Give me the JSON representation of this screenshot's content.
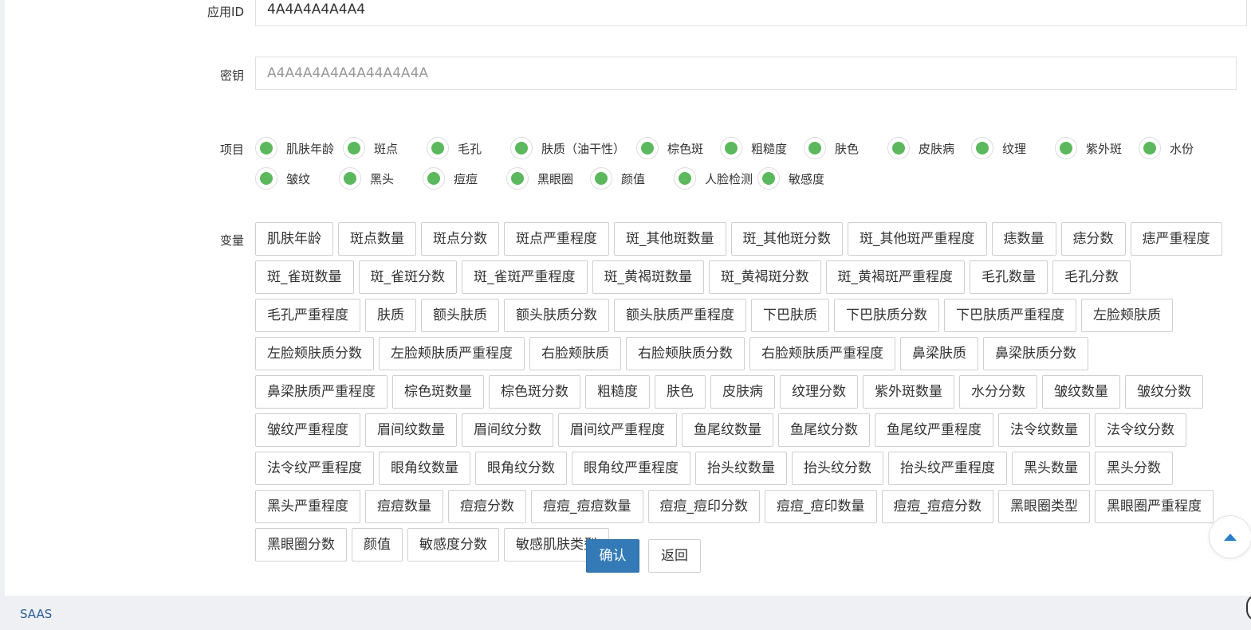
{
  "form": {
    "app_id": {
      "label": "应用ID",
      "value": "4A4A4A4A4A4"
    },
    "secret": {
      "label": "密钥",
      "placeholder": "A4A4A4A4A4A44A4A4A"
    },
    "projects": {
      "label": "项目",
      "items": [
        "肌肤年龄",
        "斑点",
        "毛孔",
        "肤质（油干性）",
        "棕色斑",
        "粗糙度",
        "肤色",
        "皮肤病",
        "纹理",
        "紫外斑",
        "水份",
        "皱纹",
        "黑头",
        "痘痘",
        "黑眼圈",
        "颜值",
        "人脸检测",
        "敏感度"
      ],
      "radio_color": "#5cb85c"
    },
    "variables": {
      "label": "变量",
      "rows": [
        [
          "肌肤年龄",
          "斑点数量",
          "斑点分数",
          "斑点严重程度",
          "斑_其他斑数量",
          "斑_其他斑分数",
          "斑_其他斑严重程度",
          "痣数量",
          "痣分数",
          "痣严重程度"
        ],
        [
          "斑_雀斑数量",
          "斑_雀斑分数",
          "斑_雀斑严重程度",
          "斑_黄褐斑数量",
          "斑_黄褐斑分数",
          "斑_黄褐斑严重程度",
          "毛孔数量",
          "毛孔分数"
        ],
        [
          "毛孔严重程度",
          "肤质",
          "额头肤质",
          "额头肤质分数",
          "额头肤质严重程度",
          "下巴肤质",
          "下巴肤质分数",
          "下巴肤质严重程度",
          "左脸颊肤质"
        ],
        [
          "左脸颊肤质分数",
          "左脸颊肤质严重程度",
          "右脸颊肤质",
          "右脸颊肤质分数",
          "右脸颊肤质严重程度",
          "鼻梁肤质",
          "鼻梁肤质分数"
        ],
        [
          "鼻梁肤质严重程度",
          "棕色斑数量",
          "棕色斑分数",
          "粗糙度",
          "肤色",
          "皮肤病",
          "纹理分数",
          "紫外斑数量",
          "水分分数",
          "皱纹数量",
          "皱纹分数"
        ],
        [
          "皱纹严重程度",
          "眉间纹数量",
          "眉间纹分数",
          "眉间纹严重程度",
          "鱼尾纹数量",
          "鱼尾纹分数",
          "鱼尾纹严重程度",
          "法令纹数量",
          "法令纹分数"
        ],
        [
          "法令纹严重程度",
          "眼角纹数量",
          "眼角纹分数",
          "眼角纹严重程度",
          "抬头纹数量",
          "抬头纹分数",
          "抬头纹严重程度",
          "黑头数量",
          "黑头分数"
        ],
        [
          "黑头严重程度",
          "痘痘数量",
          "痘痘分数",
          "痘痘_痘痘数量",
          "痘痘_痘印分数",
          "痘痘_痘印数量",
          "痘痘_痘痘分数",
          "黑眼圈类型",
          "黑眼圈严重程度"
        ],
        [
          "黑眼圈分数",
          "颜值",
          "敏感度分数",
          "敏感肌肤类型"
        ]
      ]
    },
    "confirm_label": "确认",
    "back_label": "返回",
    "primary_color": "#337ab7"
  },
  "footer": {
    "brand": "SAAS"
  },
  "icons": {
    "scroll_top": "chevron-up-icon"
  }
}
